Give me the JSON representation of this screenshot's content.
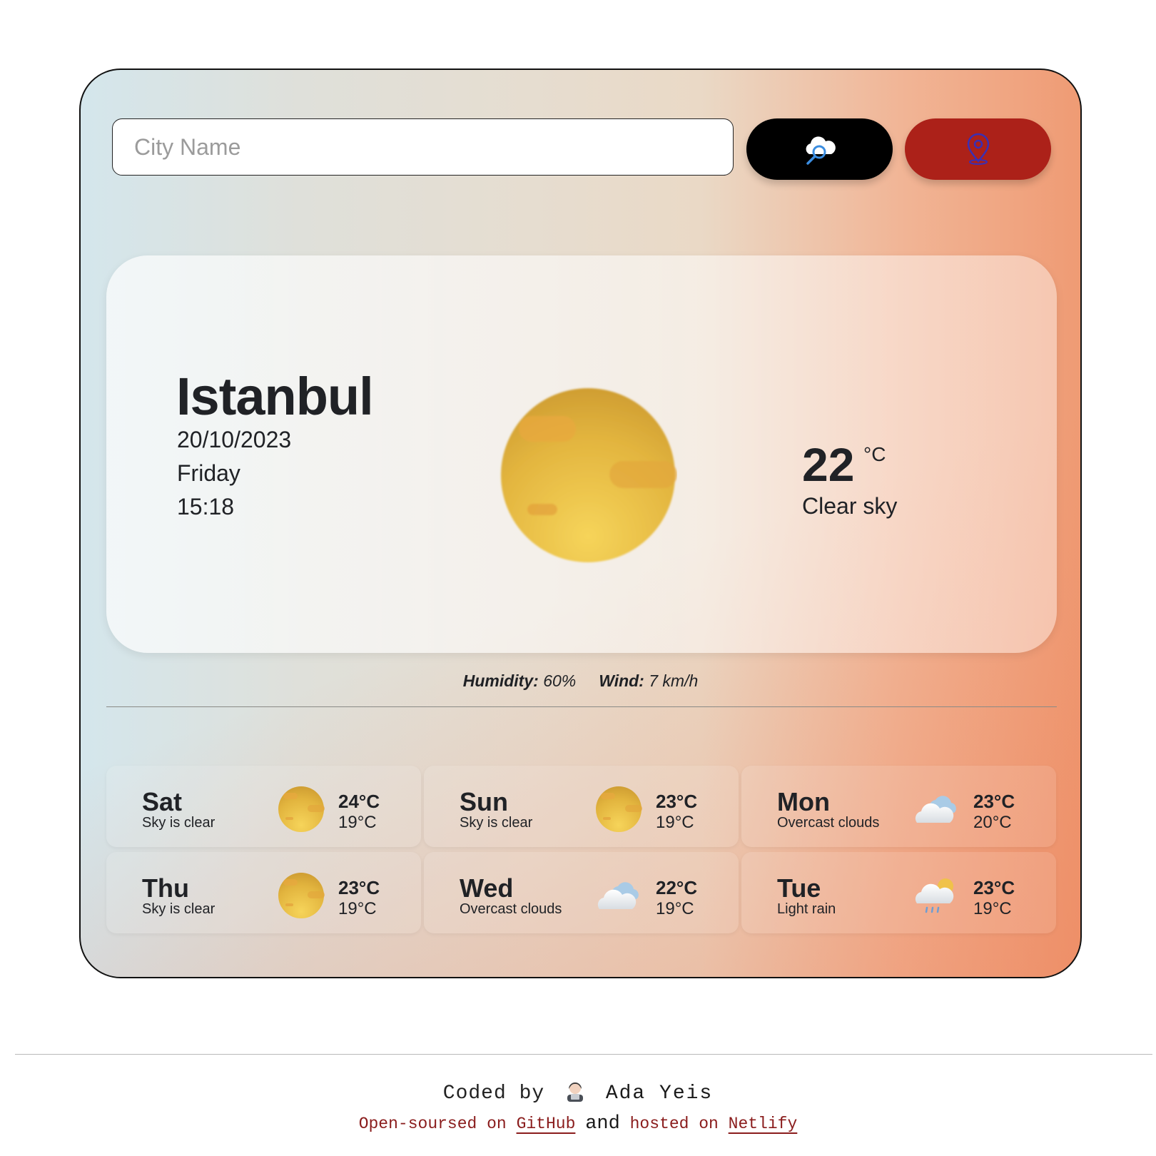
{
  "search": {
    "placeholder": "City Name",
    "search_icon": "cloud-search-icon",
    "location_icon": "map-pin-icon"
  },
  "current": {
    "city": "Istanbul",
    "date": "20/10/2023",
    "day": "Friday",
    "time": "15:18",
    "temperature": "22",
    "unit": "°C",
    "condition": "Clear sky",
    "icon": "sun-icon"
  },
  "details": {
    "humidity_label": "Humidity:",
    "humidity_value": "60%",
    "wind_label": "Wind:",
    "wind_value": "7 km/h"
  },
  "forecast": [
    {
      "day": "Sat",
      "desc": "Sky is clear",
      "icon": "sun-icon",
      "high": "24°C",
      "low": "19°C"
    },
    {
      "day": "Sun",
      "desc": "Sky is clear",
      "icon": "sun-icon",
      "high": "23°C",
      "low": "19°C"
    },
    {
      "day": "Mon",
      "desc": "Overcast clouds",
      "icon": "cloud-icon",
      "high": "23°C",
      "low": "20°C"
    },
    {
      "day": "Thu",
      "desc": "Sky is clear",
      "icon": "sun-icon",
      "high": "23°C",
      "low": "19°C"
    },
    {
      "day": "Wed",
      "desc": "Overcast clouds",
      "icon": "cloud-icon",
      "high": "22°C",
      "low": "19°C"
    },
    {
      "day": "Tue",
      "desc": "Light rain",
      "icon": "rain-cloud-icon",
      "high": "23°C",
      "low": "19°C"
    }
  ],
  "footer": {
    "coded_by": "Coded by",
    "author": "Ada Yeis",
    "open_sourced": "Open-soursed on",
    "github": "GitHub",
    "and": "and",
    "hosted": "hosted on",
    "netlify": "Netlify"
  },
  "colors": {
    "search_button": "#000000",
    "location_button": "#ac2119",
    "link": "#8a1c1c"
  }
}
